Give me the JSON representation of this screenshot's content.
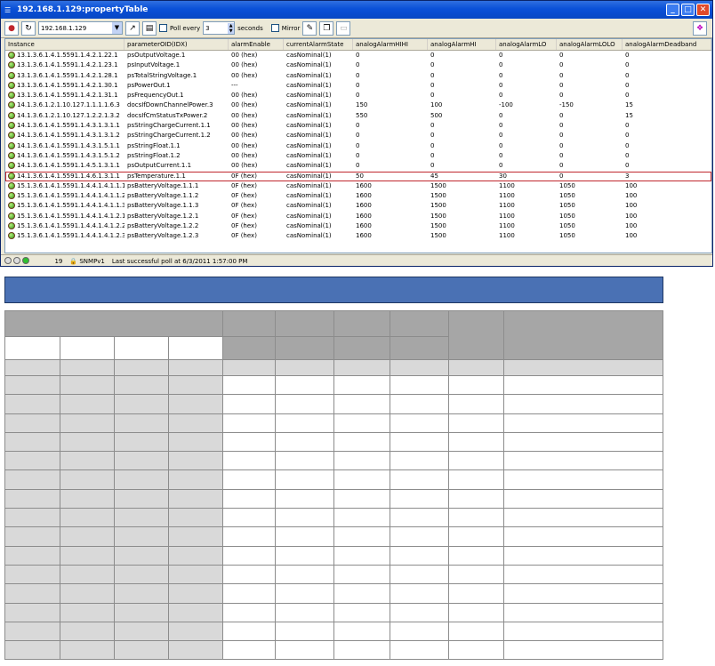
{
  "window": {
    "title": "192.168.1.129:propertyTable",
    "controls": [
      "minimize-icon",
      "maximize-icon",
      "close-icon"
    ]
  },
  "toolbar": {
    "host": "192.168.1.129",
    "poll_label": "Poll every",
    "poll_value": "3",
    "seconds_label": "seconds",
    "mirror_label": "Mirror"
  },
  "grid": {
    "columns": [
      "Instance",
      "parameterOID(IDX)",
      "alarmEnable",
      "currentAlarmState",
      "analogAlarmHIHI",
      "analogAlarmHI",
      "analogAlarmLO",
      "analogAlarmLOLO",
      "analogAlarmDeadband"
    ],
    "rows": [
      [
        "13.1.3.6.1.4.1.5591.1.4.2.1.22.1",
        "psOutputVoltage.1",
        "00 (hex)",
        "casNominal(1)",
        "0",
        "0",
        "0",
        "0",
        "0"
      ],
      [
        "13.1.3.6.1.4.1.5591.1.4.2.1.23.1",
        "psInputVoltage.1",
        "00 (hex)",
        "casNominal(1)",
        "0",
        "0",
        "0",
        "0",
        "0"
      ],
      [
        "13.1.3.6.1.4.1.5591.1.4.2.1.28.1",
        "psTotalStringVoltage.1",
        "00 (hex)",
        "casNominal(1)",
        "0",
        "0",
        "0",
        "0",
        "0"
      ],
      [
        "13.1.3.6.1.4.1.5591.1.4.2.1.30.1",
        "psPowerOut.1",
        "---",
        "casNominal(1)",
        "0",
        "0",
        "0",
        "0",
        "0"
      ],
      [
        "13.1.3.6.1.4.1.5591.1.4.2.1.31.1",
        "psFrequencyOut.1",
        "00 (hex)",
        "casNominal(1)",
        "0",
        "0",
        "0",
        "0",
        "0"
      ],
      [
        "14.1.3.6.1.2.1.10.127.1.1.1.1.6.3",
        "docsIfDownChannelPower.3",
        "00 (hex)",
        "casNominal(1)",
        "150",
        "100",
        "-100",
        "-150",
        "15"
      ],
      [
        "14.1.3.6.1.2.1.10.127.1.2.2.1.3.2",
        "docsIfCmStatusTxPower.2",
        "00 (hex)",
        "casNominal(1)",
        "550",
        "500",
        "0",
        "0",
        "15"
      ],
      [
        "14.1.3.6.1.4.1.5591.1.4.3.1.3.1.1",
        "psStringChargeCurrent.1.1",
        "00 (hex)",
        "casNominal(1)",
        "0",
        "0",
        "0",
        "0",
        "0"
      ],
      [
        "14.1.3.6.1.4.1.5591.1.4.3.1.3.1.2",
        "psStringChargeCurrent.1.2",
        "00 (hex)",
        "casNominal(1)",
        "0",
        "0",
        "0",
        "0",
        "0"
      ],
      [
        "14.1.3.6.1.4.1.5591.1.4.3.1.5.1.1",
        "psStringFloat.1.1",
        "00 (hex)",
        "casNominal(1)",
        "0",
        "0",
        "0",
        "0",
        "0"
      ],
      [
        "14.1.3.6.1.4.1.5591.1.4.3.1.5.1.2",
        "psStringFloat.1.2",
        "00 (hex)",
        "casNominal(1)",
        "0",
        "0",
        "0",
        "0",
        "0"
      ],
      [
        "14.1.3.6.1.4.1.5591.1.4.5.1.3.1.1",
        "psOutputCurrent.1.1",
        "00 (hex)",
        "casNominal(1)",
        "0",
        "0",
        "0",
        "0",
        "0"
      ],
      [
        "14.1.3.6.1.4.1.5591.1.4.6.1.3.1.1",
        "psTemperature.1.1",
        "0F (hex)",
        "casNominal(1)",
        "50",
        "45",
        "30",
        "0",
        "3"
      ],
      [
        "15.1.3.6.1.4.1.5591.1.4.4.1.4.1.1.1",
        "psBatteryVoltage.1.1.1",
        "0F (hex)",
        "casNominal(1)",
        "1600",
        "1500",
        "1100",
        "1050",
        "100"
      ],
      [
        "15.1.3.6.1.4.1.5591.1.4.4.1.4.1.1.2",
        "psBatteryVoltage.1.1.2",
        "0F (hex)",
        "casNominal(1)",
        "1600",
        "1500",
        "1100",
        "1050",
        "100"
      ],
      [
        "15.1.3.6.1.4.1.5591.1.4.4.1.4.1.1.3",
        "psBatteryVoltage.1.1.3",
        "0F (hex)",
        "casNominal(1)",
        "1600",
        "1500",
        "1100",
        "1050",
        "100"
      ],
      [
        "15.1.3.6.1.4.1.5591.1.4.4.1.4.1.2.1",
        "psBatteryVoltage.1.2.1",
        "0F (hex)",
        "casNominal(1)",
        "1600",
        "1500",
        "1100",
        "1050",
        "100"
      ],
      [
        "15.1.3.6.1.4.1.5591.1.4.4.1.4.1.2.2",
        "psBatteryVoltage.1.2.2",
        "0F (hex)",
        "casNominal(1)",
        "1600",
        "1500",
        "1100",
        "1050",
        "100"
      ],
      [
        "15.1.3.6.1.4.1.5591.1.4.4.1.4.1.2.3",
        "psBatteryVoltage.1.2.3",
        "0F (hex)",
        "casNominal(1)",
        "1600",
        "1500",
        "1100",
        "1050",
        "100"
      ]
    ],
    "selected_row": 12
  },
  "statusbar": {
    "count": "19",
    "protocol": "SNMPv1",
    "message": "Last successful poll at 6/3/2011 1:57:00 PM"
  },
  "colors": {
    "title_blue": "#0a50d8",
    "selected_outline": "#c0272d",
    "doc_header_bar": "#4a71b4",
    "doc_header_gray": "#a6a6a6",
    "doc_row_gray": "#d9d9d9"
  }
}
